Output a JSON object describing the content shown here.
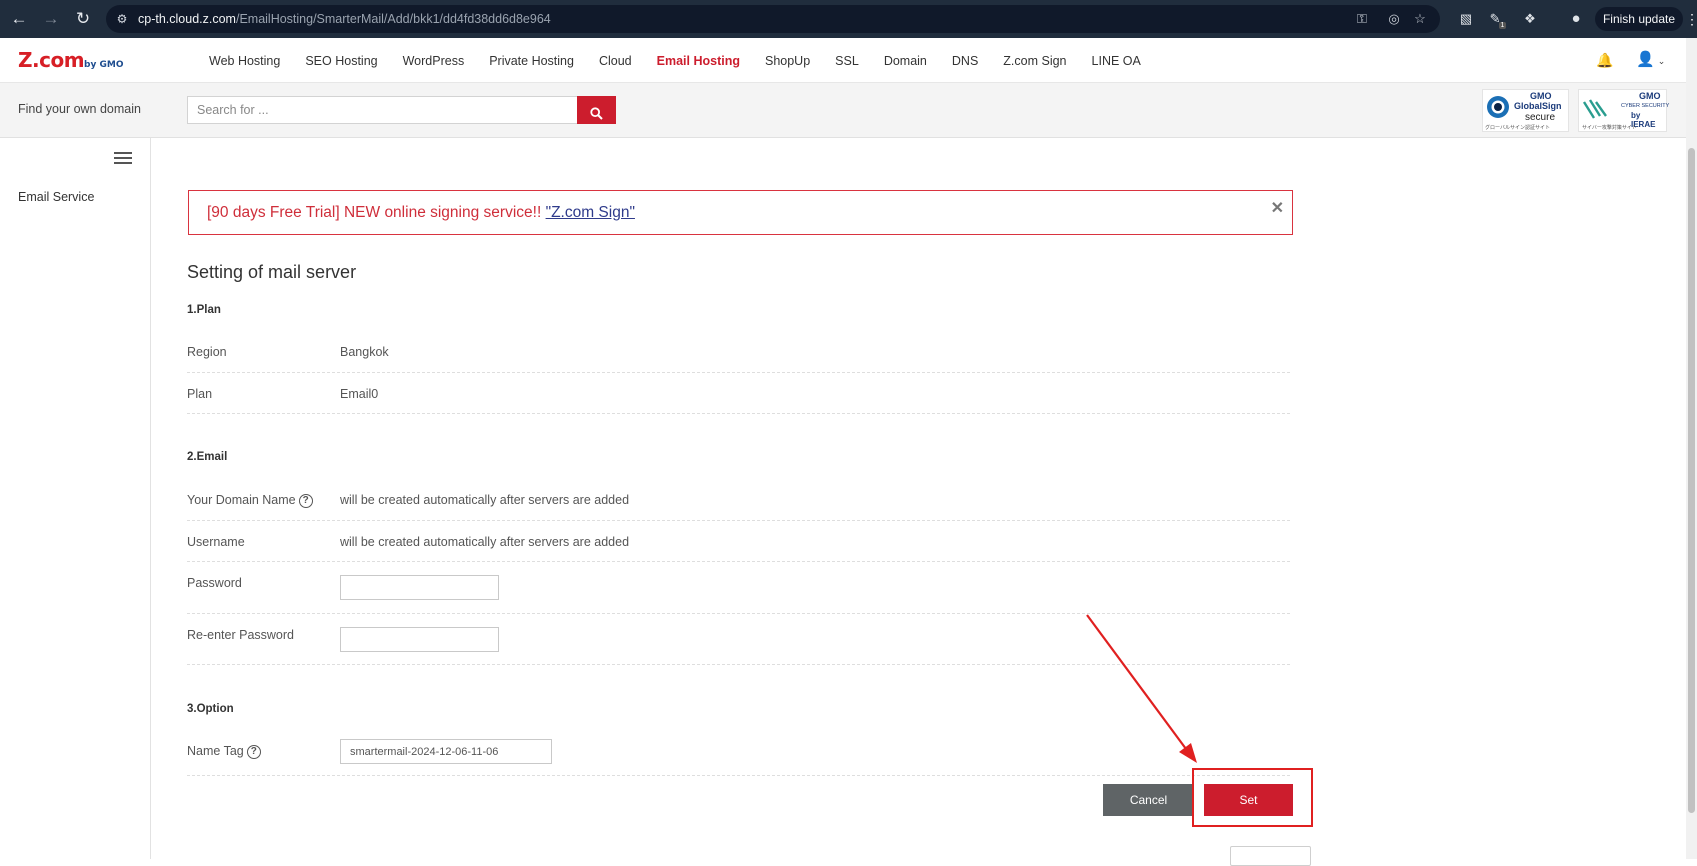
{
  "browser": {
    "url_host": "cp-th.cloud.z.com",
    "url_path": "/EmailHosting/SmarterMail/Add/bkk1/dd4fd38dd6d8e964",
    "finish_update": "Finish update",
    "extension_badge": "1"
  },
  "header": {
    "logo_text": "Z.com",
    "logo_by": "by GMO",
    "nav": [
      {
        "label": "Web Hosting"
      },
      {
        "label": "SEO Hosting"
      },
      {
        "label": "WordPress"
      },
      {
        "label": "Private Hosting"
      },
      {
        "label": "Cloud"
      },
      {
        "label": "Email Hosting",
        "active": true
      },
      {
        "label": "ShopUp"
      },
      {
        "label": "SSL"
      },
      {
        "label": "Domain"
      },
      {
        "label": "DNS"
      },
      {
        "label": "Z.com Sign"
      },
      {
        "label": "LINE OA"
      }
    ]
  },
  "search": {
    "find_label": "Find your own domain",
    "placeholder": "Search for ..."
  },
  "seals": {
    "globalsign": {
      "line1": "GMO",
      "line2": "GlobalSign",
      "line3": "secure",
      "line4": "グローバルサイン認証サイト"
    },
    "ierae": {
      "line1": "GMO",
      "line2": "CYBER SECURITY",
      "line3": "by IERAE",
      "line4": "サイバー攻撃対策サイト"
    }
  },
  "sidebar": {
    "items": [
      {
        "label": "Email Service"
      }
    ]
  },
  "banner": {
    "text": "[90 days Free Trial] NEW online signing service!! ",
    "link": "\"Z.com Sign\""
  },
  "form": {
    "title": "Setting of mail server",
    "section_plan": "1.Plan",
    "region_label": "Region",
    "region_value": "Bangkok",
    "plan_label": "Plan",
    "plan_value": "Email0",
    "section_email": "2.Email",
    "domain_label": "Your Domain Name",
    "domain_value": "will be created automatically after servers are added",
    "username_label": "Username",
    "username_value": "will be created automatically after servers are added",
    "password_label": "Password",
    "password_value": "",
    "reenter_label": "Re-enter Password",
    "reenter_value": "",
    "section_option": "3.Option",
    "nametag_label": "Name Tag",
    "nametag_value": "smartermail-2024-12-06-11-06",
    "cancel_label": "Cancel",
    "set_label": "Set"
  },
  "colors": {
    "brand_red": "#cc1d2d",
    "annotation_red": "#e02020",
    "cancel_gray": "#5f6466"
  }
}
